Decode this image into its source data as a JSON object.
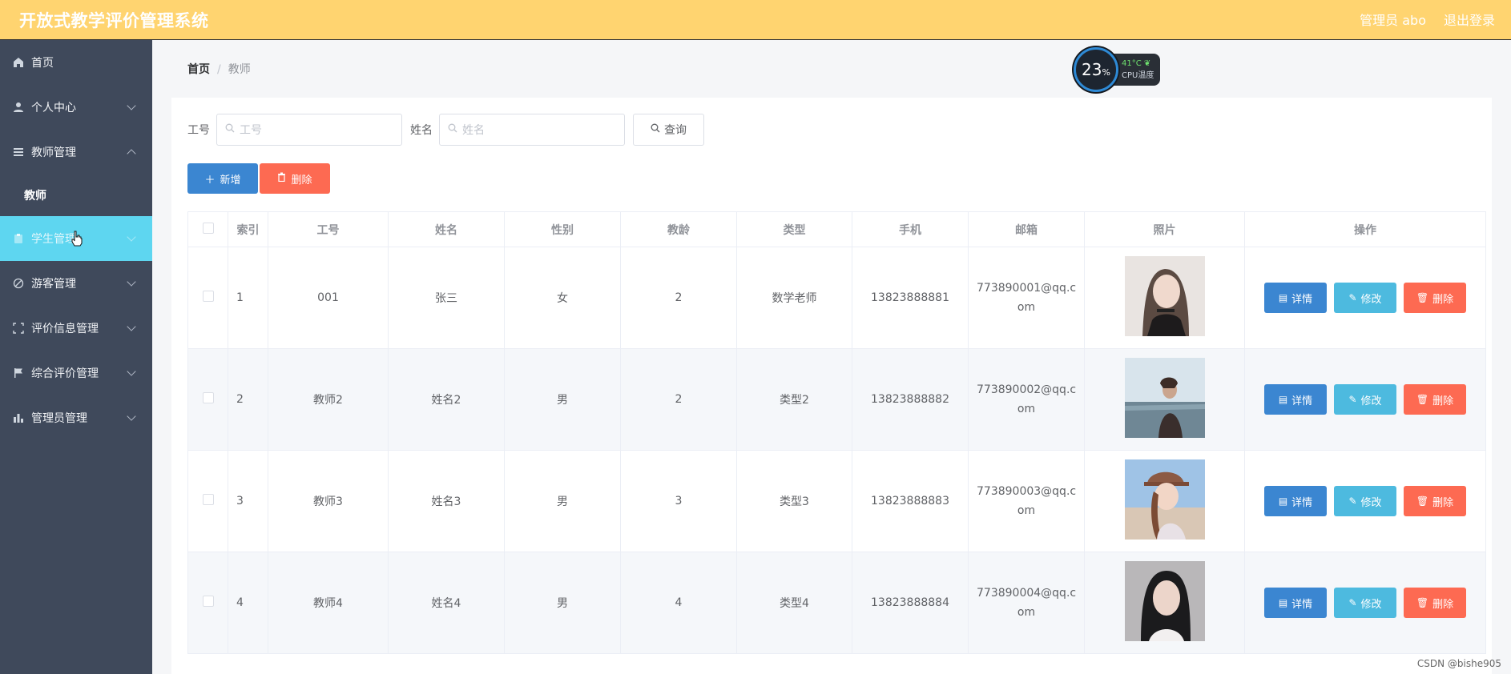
{
  "app": {
    "title": "开放式教学评价管理系统"
  },
  "topbar": {
    "admin": "管理员 abo",
    "logout": "退出登录"
  },
  "sidebar": {
    "items": [
      {
        "label": "首页"
      },
      {
        "label": "个人中心"
      },
      {
        "label": "教师管理"
      },
      {
        "label": "教师"
      },
      {
        "label": "学生管理"
      },
      {
        "label": "游客管理"
      },
      {
        "label": "评价信息管理"
      },
      {
        "label": "综合评价管理"
      },
      {
        "label": "管理员管理"
      }
    ]
  },
  "breadcrumb": {
    "home": "首页",
    "sep": "/",
    "current": "教师"
  },
  "cpu": {
    "percent": "23",
    "unit": "%",
    "temp": "41°C",
    "label": "CPU温度"
  },
  "search": {
    "id_label": "工号",
    "id_placeholder": "工号",
    "name_label": "姓名",
    "name_placeholder": "姓名",
    "query": "查询"
  },
  "actions": {
    "add": "新增",
    "delete": "删除"
  },
  "table": {
    "headers": [
      "索引",
      "工号",
      "姓名",
      "性别",
      "教龄",
      "类型",
      "手机",
      "邮箱",
      "照片",
      "操作"
    ],
    "rows": [
      {
        "index": "1",
        "id": "001",
        "name": "张三",
        "gender": "女",
        "years": "2",
        "type": "数学老师",
        "phone": "13823888881",
        "email_a": "773890001@qq.c",
        "email_b": "om"
      },
      {
        "index": "2",
        "id": "教师2",
        "name": "姓名2",
        "gender": "男",
        "years": "2",
        "type": "类型2",
        "phone": "13823888882",
        "email_a": "773890002@qq.c",
        "email_b": "om"
      },
      {
        "index": "3",
        "id": "教师3",
        "name": "姓名3",
        "gender": "男",
        "years": "3",
        "type": "类型3",
        "phone": "13823888883",
        "email_a": "773890003@qq.c",
        "email_b": "om"
      },
      {
        "index": "4",
        "id": "教师4",
        "name": "姓名4",
        "gender": "男",
        "years": "4",
        "type": "类型4",
        "phone": "13823888884",
        "email_a": "773890004@qq.c",
        "email_b": "om"
      }
    ],
    "ops": {
      "detail": "详情",
      "edit": "修改",
      "delete": "删除"
    }
  },
  "watermark": "CSDN @bishe905",
  "colors": {
    "topbar": "#ffd470",
    "sidebar": "#3f495b",
    "active": "#5ed6f0",
    "primary": "#3b86d1",
    "info": "#4dbadf",
    "danger": "#fd6a52"
  }
}
